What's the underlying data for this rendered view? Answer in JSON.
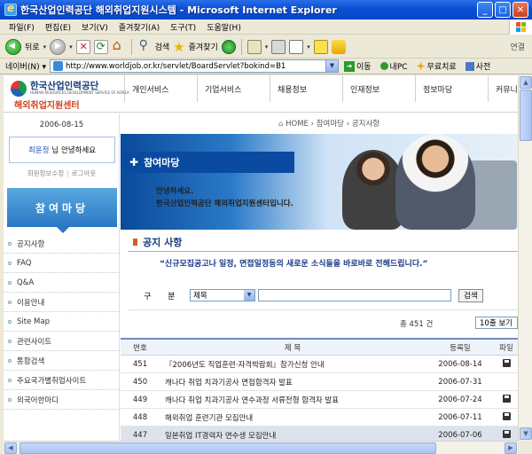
{
  "window": {
    "title": "한국산업인력공단 해외취업지원시스템 - Microsoft Internet Explorer"
  },
  "menubar": {
    "items": [
      "파일(F)",
      "편집(E)",
      "보기(V)",
      "즐겨찾기(A)",
      "도구(T)",
      "도움말(H)"
    ]
  },
  "toolbar": {
    "back": "뒤로",
    "search": "검색",
    "favorites": "즐겨찾기",
    "links": "연결"
  },
  "addressbar": {
    "label": "네이버(N) ▾",
    "url": "http://www.worldjob.or.kr/servlet/BoardServlet?bokind=B1",
    "go": "이동",
    "extras": [
      "내PC",
      "무료치료",
      "사전"
    ]
  },
  "site": {
    "logo_name": "한국산업인력공단",
    "logo_eng": "HUMAN RESOURCES DEVELOPMENT SERVICE OF KOREA",
    "logo_sub": "해외취업지원센터",
    "nav": [
      "개인서비스",
      "기업서비스",
      "채용정보",
      "인재정보",
      "정보마당",
      "커뮤니티"
    ]
  },
  "sidebar": {
    "date": "2006-08-15",
    "user_name": "최윤정",
    "greeting": "님 안녕하세요",
    "account_links": [
      "회원정보수정",
      "로그아웃"
    ],
    "title": "참여마당",
    "menu": [
      "공지사항",
      "FAQ",
      "Q&A",
      "이용안내",
      "Site Map",
      "관련사이트",
      "통합검색",
      "주요국가별취업사이트",
      "외국어한마디"
    ]
  },
  "breadcrumb": {
    "home": "HOME",
    "sep": "›",
    "items": [
      "참여마당",
      "공지사항"
    ]
  },
  "banner": {
    "title": "참여마당",
    "line1": "안녕하세요.",
    "line2": "한국산업인력공단 해외취업지원센터입니다."
  },
  "notice": {
    "section_title": "공지 사항",
    "intro": "“신규모집공고나 일정, 면접일정등의 새로운 소식들을 바로바로 전해드립니다.”",
    "search_label": "구 분",
    "search_select": "제목",
    "search_button": "검색",
    "total": "총 451 건",
    "per_page": "10줄 보기",
    "headers": {
      "no": "번호",
      "title": "제 목",
      "date": "등록일",
      "file": "파일"
    },
    "rows": [
      {
        "no": "451",
        "title": "『2006년도 직업훈련·자격박람회』참가신청 안내",
        "date": "2006-08-14",
        "file": true
      },
      {
        "no": "450",
        "title": "캐나다 취업 치과기공사 면접합격자 발표",
        "date": "2006-07-31",
        "file": false
      },
      {
        "no": "449",
        "title": "캐나다 취업 치과기공사 연수과정 서류전형 합격자 발표",
        "date": "2006-07-24",
        "file": true
      },
      {
        "no": "448",
        "title": "해외취업 훈련기관 모집안내",
        "date": "2006-07-11",
        "file": true
      },
      {
        "no": "447",
        "title": "일본취업 IT경력자 연수생 모집안내",
        "date": "2006-07-06",
        "file": true
      }
    ]
  }
}
